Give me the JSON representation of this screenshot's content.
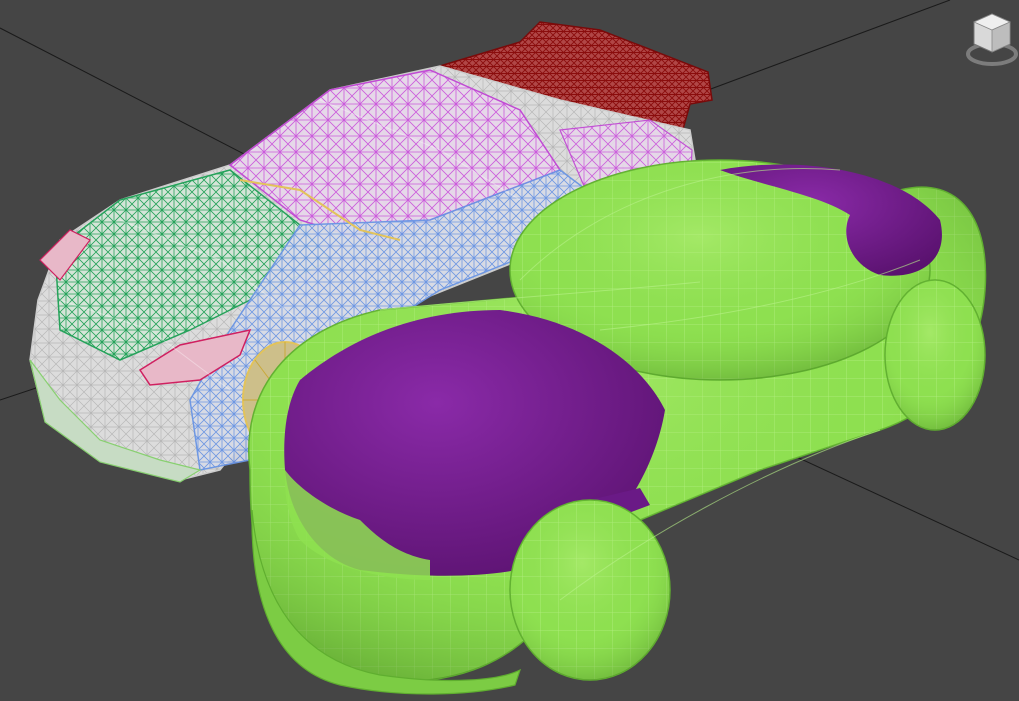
{
  "viewport": {
    "background": "#454545",
    "grid_color": "#1a1a1a"
  },
  "viewcube": {
    "icon": "viewcube-icon",
    "faces": [
      "",
      ""
    ]
  },
  "objects": [
    {
      "name": "sports-car-wireframe",
      "colors": [
        "#e8e8e8",
        "#cc66e0",
        "#22b05a",
        "#6f9be6",
        "#9b1010",
        "#e2c35a",
        "#d02060"
      ]
    },
    {
      "name": "blob-car-proxy-mesh",
      "colors": [
        "#8ee050",
        "#6a1a86"
      ]
    }
  ]
}
